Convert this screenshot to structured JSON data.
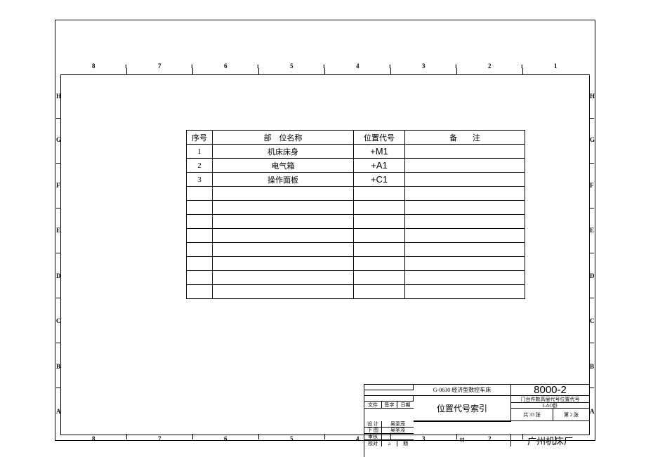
{
  "ruler_top": [
    "8",
    "7",
    "6",
    "5",
    "4",
    "3",
    "2",
    "1"
  ],
  "ruler_i": [
    "I",
    "I",
    "I",
    "I",
    "I",
    "I",
    "I"
  ],
  "side_letters": [
    "H",
    "G",
    "F",
    "E",
    "D",
    "C",
    "B",
    "A"
  ],
  "table": {
    "headers": {
      "seq": "序号",
      "name": "部　位名称",
      "code": "位置代号",
      "remark": "备　　注"
    },
    "rows": [
      {
        "seq": "1",
        "name": "机床床身",
        "code": "+M1",
        "remark": ""
      },
      {
        "seq": "2",
        "name": "电气箱",
        "code": "+A1",
        "remark": ""
      },
      {
        "seq": "3",
        "name": "操作面板",
        "code": "+C1",
        "remark": ""
      },
      {
        "seq": "",
        "name": "",
        "code": "",
        "remark": ""
      },
      {
        "seq": "",
        "name": "",
        "code": "",
        "remark": ""
      },
      {
        "seq": "",
        "name": "",
        "code": "",
        "remark": ""
      },
      {
        "seq": "",
        "name": "",
        "code": "",
        "remark": ""
      },
      {
        "seq": "",
        "name": "",
        "code": "",
        "remark": ""
      },
      {
        "seq": "",
        "name": "",
        "code": "",
        "remark": ""
      },
      {
        "seq": "",
        "name": "",
        "code": "",
        "remark": ""
      },
      {
        "seq": "",
        "name": "",
        "code": "",
        "remark": ""
      }
    ]
  },
  "title_block": {
    "product": "G-0630 经济型数控车床",
    "drawing_no": "8000-2",
    "file_label": "文件",
    "sign_label": "签字",
    "date_label": "日期",
    "subtitle": "门台件数高层代号位置代号",
    "design_label": "设 计",
    "designer": "吴圣茂",
    "draft_label": "下 图",
    "drafter": "吴圣茂",
    "check_label": "审核",
    "proof_label": "校对",
    "title": "位置代号索引",
    "format": "I-AO卧",
    "sheet_total": "共 33 张",
    "sheet_no": "第 2 张",
    "a": "a",
    "period": "期",
    "material": "材",
    "company": "广州机床厂"
  }
}
